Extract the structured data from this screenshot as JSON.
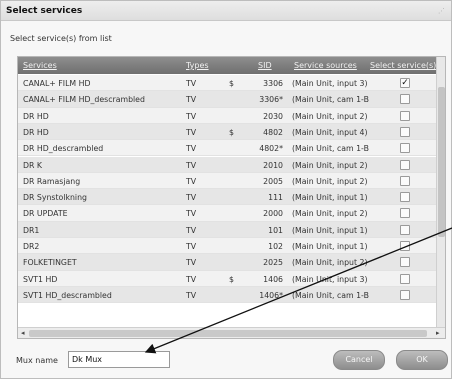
{
  "dialog": {
    "title": "Select services",
    "subtitle": "Select service(s) from list",
    "resize_icon": "resize-grip-icon"
  },
  "grid": {
    "headers": [
      "Services",
      "Types",
      "SID",
      "Service sources",
      "Select service(s)"
    ],
    "rows": [
      {
        "name": "CANAL+ FILM HD",
        "type": "TV",
        "currency": "$",
        "sid": "3306",
        "source": "(Main Unit, input 3)",
        "checked": true
      },
      {
        "name": "CANAL+ FILM HD_descrambled",
        "type": "TV",
        "currency": "",
        "sid": "3306*",
        "source": "(Main Unit, cam 1-B",
        "checked": false
      },
      {
        "name": "DR HD",
        "type": "TV",
        "currency": "",
        "sid": "2030",
        "source": "(Main Unit, input 2)",
        "checked": false
      },
      {
        "name": "DR HD",
        "type": "TV",
        "currency": "$",
        "sid": "4802",
        "source": "(Main Unit, input 4)",
        "checked": false
      },
      {
        "name": "DR HD_descrambled",
        "type": "TV",
        "currency": "",
        "sid": "4802*",
        "source": "(Main Unit, cam 1-B",
        "checked": false
      },
      {
        "name": "DR K",
        "type": "TV",
        "currency": "",
        "sid": "2010",
        "source": "(Main Unit, input 2)",
        "checked": false
      },
      {
        "name": "DR Ramasjang",
        "type": "TV",
        "currency": "",
        "sid": "2005",
        "source": "(Main Unit, input 2)",
        "checked": false
      },
      {
        "name": "DR Synstolkning",
        "type": "TV",
        "currency": "",
        "sid": "111",
        "source": "(Main Unit, input 1)",
        "checked": false
      },
      {
        "name": "DR UPDATE",
        "type": "TV",
        "currency": "",
        "sid": "2000",
        "source": "(Main Unit, input 2)",
        "checked": false
      },
      {
        "name": "DR1",
        "type": "TV",
        "currency": "",
        "sid": "101",
        "source": "(Main Unit, input 1)",
        "checked": false
      },
      {
        "name": "DR2",
        "type": "TV",
        "currency": "",
        "sid": "102",
        "source": "(Main Unit, input 1)",
        "checked": false
      },
      {
        "name": "FOLKETINGET",
        "type": "TV",
        "currency": "",
        "sid": "2025",
        "source": "(Main Unit, input 2)",
        "checked": false
      },
      {
        "name": "SVT1 HD",
        "type": "TV",
        "currency": "$",
        "sid": "1406",
        "source": "(Main Unit, input 3)",
        "checked": false
      },
      {
        "name": "SVT1 HD_descrambled",
        "type": "TV",
        "currency": "",
        "sid": "1406*",
        "source": "(Main Unit, cam 1-B",
        "checked": false
      }
    ],
    "scroll_left_icon": "arrow-left-icon",
    "scroll_right_icon": "arrow-right-icon"
  },
  "footer": {
    "mux_label": "Mux name",
    "mux_value": "Dk Mux",
    "cancel_label": "Cancel",
    "ok_label": "OK"
  },
  "annotation": {
    "arrow_icon": "pointer-arrow-icon",
    "arrow_color": "#111111"
  }
}
